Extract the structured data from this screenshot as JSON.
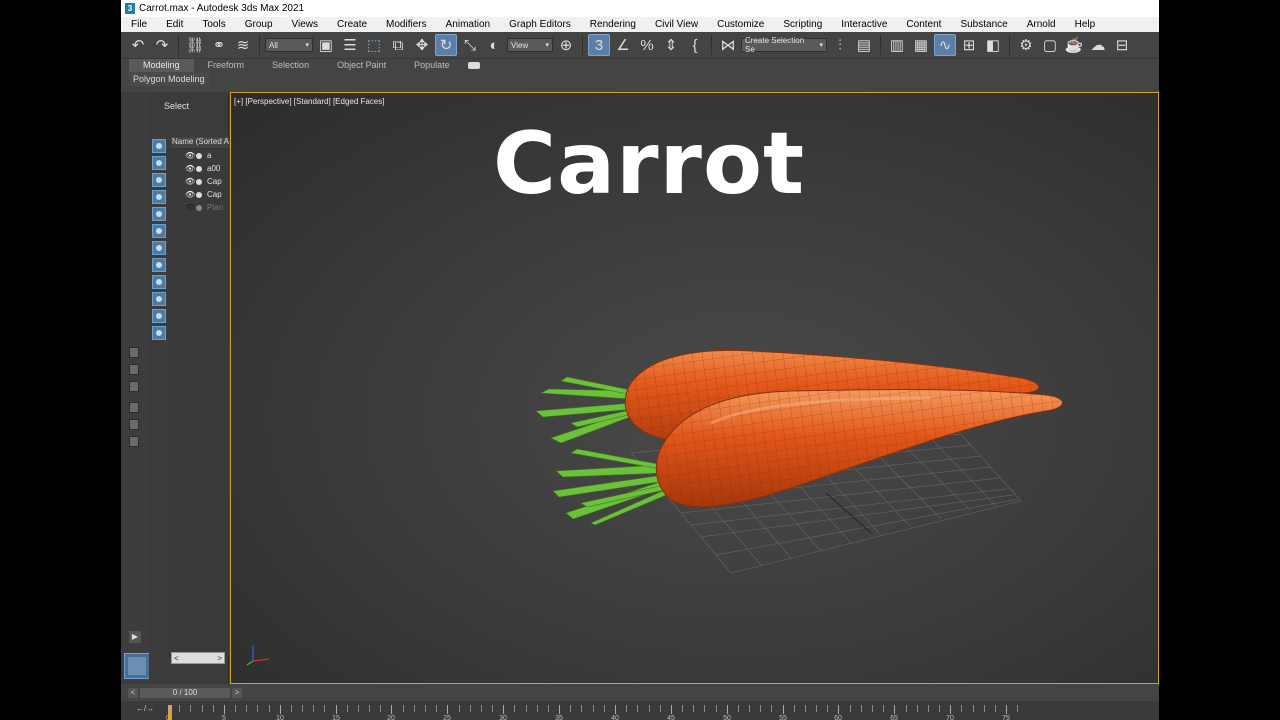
{
  "window": {
    "title": "Carrot.max - Autodesk 3ds Max 2021"
  },
  "menu": [
    "File",
    "Edit",
    "Tools",
    "Group",
    "Views",
    "Create",
    "Modifiers",
    "Animation",
    "Graph Editors",
    "Rendering",
    "Civil View",
    "Customize",
    "Scripting",
    "Interactive",
    "Content",
    "Substance",
    "Arnold",
    "Help"
  ],
  "toolbar": {
    "selection_filter": "All",
    "reference_coord": "View",
    "named_selection": "Create Selection Se",
    "icons": [
      "undo-icon",
      "redo-icon",
      "link-icon",
      "unlink-icon",
      "bind-space-warp-icon",
      "select-object-icon",
      "select-by-name-icon",
      "rect-selection-icon",
      "window-crossing-icon",
      "select-move-icon",
      "select-rotate-icon",
      "select-scale-icon",
      "place-icon",
      "pivot-icon",
      "snap-toggle-icon",
      "angle-snap-icon",
      "percent-snap-icon",
      "spinner-snap-icon",
      "edit-named-selection-icon",
      "mirror-icon",
      "align-icon",
      "scene-explorer-icon",
      "layer-explorer-icon",
      "ribbon-toggle-icon",
      "curve-editor-icon",
      "schematic-view-icon",
      "material-editor-icon",
      "render-setup-icon",
      "rendered-frame-icon",
      "render-icon",
      "render-cloud-icon",
      "viewport-layout-icon"
    ]
  },
  "ribbon": {
    "tabs": [
      "Modeling",
      "Freeform",
      "Selection",
      "Object Paint",
      "Populate"
    ],
    "active_tab": "Modeling",
    "subpanel": "Polygon Modeling"
  },
  "scene_explorer": {
    "mode_label": "Select",
    "column_header": "Name (Sorted A",
    "items": [
      {
        "name": "a",
        "visible": true
      },
      {
        "name": "a00",
        "visible": true
      },
      {
        "name": "Cap",
        "visible": true
      },
      {
        "name": "Cap",
        "visible": true
      },
      {
        "name": "Plan",
        "visible": false
      }
    ]
  },
  "viewport": {
    "label": "[+] [Perspective] [Standard] [Edged Faces]",
    "overlay_title": "Carrot"
  },
  "timeline": {
    "frame_display": "0 / 100",
    "prev": "<",
    "next": ">",
    "current_frame": 0,
    "ticks": [
      "0",
      "5",
      "10",
      "15",
      "20",
      "25",
      "30",
      "35",
      "40",
      "45",
      "50",
      "55",
      "60",
      "65",
      "70",
      "75"
    ],
    "track_button": "←/→"
  },
  "colors": {
    "carrot_body": "#e0541a",
    "carrot_leaves": "#6cc13a",
    "viewport_border": "#d0a030",
    "accent_active": "#5b7fa6"
  }
}
